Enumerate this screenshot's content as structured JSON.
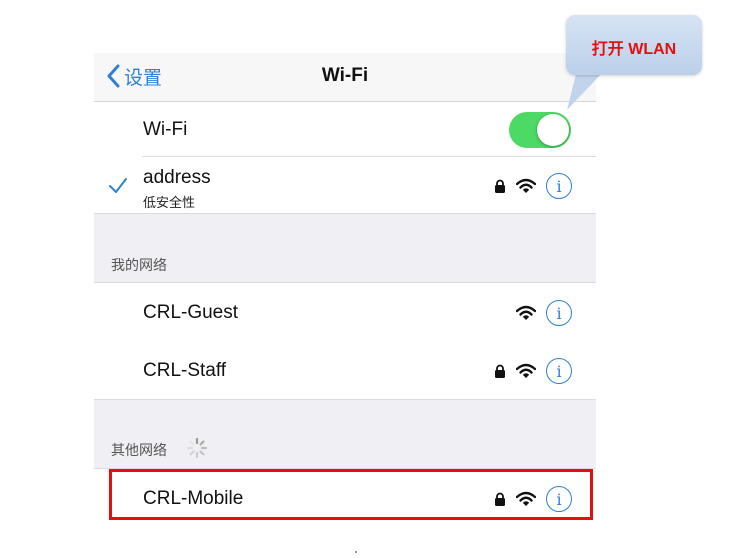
{
  "navbar": {
    "back_label": "设置",
    "title": "Wi-Fi"
  },
  "wifi_toggle": {
    "label": "Wi-Fi",
    "state": "on",
    "on_color": "#4cd964"
  },
  "connected": {
    "name": "address",
    "security_note": "低安全性",
    "locked": true
  },
  "my_networks": {
    "title": "我的网络",
    "items": [
      {
        "name": "CRL-Guest",
        "locked": false
      },
      {
        "name": "CRL-Staff",
        "locked": true
      }
    ]
  },
  "other_networks": {
    "title": "其他网络",
    "items": [
      {
        "name": "CRL-Mobile",
        "locked": true
      }
    ]
  },
  "callout": {
    "text": "打开 WLAN",
    "text_color": "#e3100f"
  },
  "colors": {
    "accent": "#2f80d6",
    "highlight_border": "#e3100f"
  },
  "icons": {
    "back": "chevron-left-icon",
    "check": "checkmark-icon",
    "lock": "lock-icon",
    "wifi": "wifi-icon",
    "info": "info-icon",
    "spinner": "spinner-icon"
  }
}
